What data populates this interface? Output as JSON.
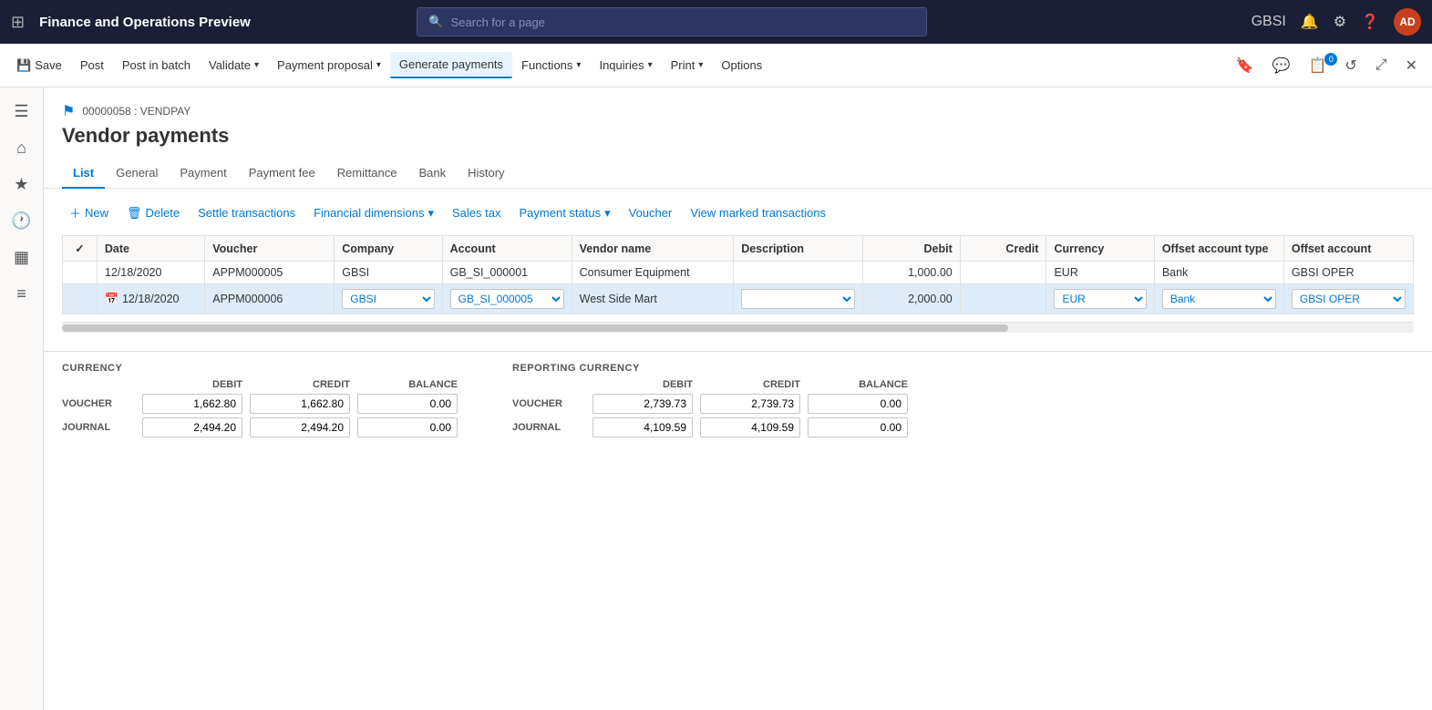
{
  "app": {
    "title": "Finance and Operations Preview",
    "search_placeholder": "Search for a page",
    "user_initials": "AD",
    "user_company": "GBSI"
  },
  "action_bar": {
    "save_label": "Save",
    "post_label": "Post",
    "post_in_batch_label": "Post in batch",
    "validate_label": "Validate",
    "payment_proposal_label": "Payment proposal",
    "generate_payments_label": "Generate payments",
    "functions_label": "Functions",
    "inquiries_label": "Inquiries",
    "print_label": "Print",
    "options_label": "Options"
  },
  "breadcrumb": "00000058 : VENDPAY",
  "page_title": "Vendor payments",
  "tabs": [
    {
      "id": "list",
      "label": "List",
      "active": true
    },
    {
      "id": "general",
      "label": "General",
      "active": false
    },
    {
      "id": "payment",
      "label": "Payment",
      "active": false
    },
    {
      "id": "payment_fee",
      "label": "Payment fee",
      "active": false
    },
    {
      "id": "remittance",
      "label": "Remittance",
      "active": false
    },
    {
      "id": "bank",
      "label": "Bank",
      "active": false
    },
    {
      "id": "history",
      "label": "History",
      "active": false
    }
  ],
  "toolbar": {
    "new_label": "New",
    "delete_label": "Delete",
    "settle_transactions_label": "Settle transactions",
    "financial_dimensions_label": "Financial dimensions",
    "sales_tax_label": "Sales tax",
    "payment_status_label": "Payment status",
    "voucher_label": "Voucher",
    "view_marked_label": "View marked transactions"
  },
  "table": {
    "columns": [
      {
        "id": "check",
        "label": ""
      },
      {
        "id": "date",
        "label": "Date"
      },
      {
        "id": "voucher",
        "label": "Voucher"
      },
      {
        "id": "company",
        "label": "Company"
      },
      {
        "id": "account",
        "label": "Account"
      },
      {
        "id": "vendor_name",
        "label": "Vendor name"
      },
      {
        "id": "description",
        "label": "Description"
      },
      {
        "id": "debit",
        "label": "Debit"
      },
      {
        "id": "credit",
        "label": "Credit"
      },
      {
        "id": "currency",
        "label": "Currency"
      },
      {
        "id": "offset_account_type",
        "label": "Offset account type"
      },
      {
        "id": "offset_account",
        "label": "Offset account"
      }
    ],
    "rows": [
      {
        "selected": false,
        "date": "12/18/2020",
        "voucher": "APPM000005",
        "company": "GBSI",
        "account": "GB_SI_000001",
        "vendor_name": "Consumer Equipment",
        "description": "",
        "debit": "1,000.00",
        "credit": "",
        "currency": "EUR",
        "offset_account_type": "Bank",
        "offset_account": "GBSI OPER"
      },
      {
        "selected": true,
        "date": "12/18/2020",
        "voucher": "APPM000006",
        "company": "GBSI",
        "account": "GB_SI_000005",
        "vendor_name": "West Side Mart",
        "description": "",
        "debit": "2,000.00",
        "credit": "",
        "currency": "EUR",
        "offset_account_type": "Bank",
        "offset_account": "GBSI OPER"
      }
    ]
  },
  "summary": {
    "currency_title": "CURRENCY",
    "reporting_currency_title": "REPORTING CURRENCY",
    "debit_label": "DEBIT",
    "credit_label": "CREDIT",
    "balance_label": "BALANCE",
    "voucher_label": "VOUCHER",
    "journal_label": "JOURNAL",
    "currency": {
      "voucher_debit": "1,662.80",
      "voucher_credit": "1,662.80",
      "voucher_balance": "0.00",
      "journal_debit": "2,494.20",
      "journal_credit": "2,494.20",
      "journal_balance": "0.00"
    },
    "reporting_currency": {
      "voucher_debit": "2,739.73",
      "voucher_credit": "2,739.73",
      "voucher_balance": "0.00",
      "journal_debit": "4,109.59",
      "journal_credit": "4,109.59",
      "journal_balance": "0.00"
    }
  }
}
